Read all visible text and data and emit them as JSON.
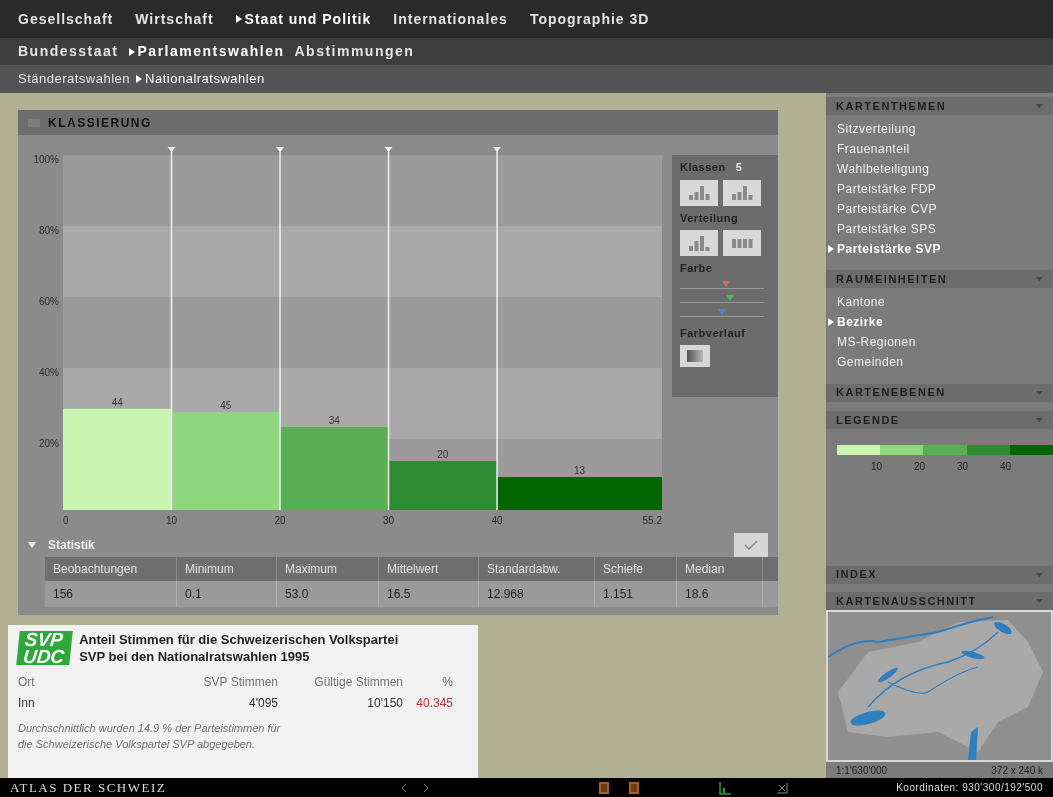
{
  "nav": {
    "level1": [
      {
        "label": "Gesellschaft",
        "selected": false
      },
      {
        "label": "Wirtschaft",
        "selected": false
      },
      {
        "label": "Staat und Politik",
        "selected": true
      },
      {
        "label": "Internationales",
        "selected": false
      },
      {
        "label": "Topographie 3D",
        "selected": false
      }
    ],
    "level2": [
      {
        "label": "Bundesstaat",
        "selected": false
      },
      {
        "label": "Parlamentswahlen",
        "selected": true
      },
      {
        "label": "Abstimmungen",
        "selected": false
      }
    ],
    "level3": [
      {
        "label": "Ständeratswahlen",
        "selected": false
      },
      {
        "label": "Nationalratswahlen",
        "selected": true
      }
    ]
  },
  "classification": {
    "title": "KLASSIERUNG",
    "chart_data": {
      "type": "bar",
      "grid": true,
      "x": [
        5,
        15,
        25,
        35,
        47.6
      ],
      "xlim": [
        0,
        55.2
      ],
      "xticks": [
        0,
        10,
        20,
        30,
        40,
        55.2
      ],
      "ylim": [
        0,
        100
      ],
      "yticks": [
        {
          "value": 20,
          "label": "20%"
        },
        {
          "value": 40,
          "label": "40%"
        },
        {
          "value": 60,
          "label": "60%"
        },
        {
          "value": 80,
          "label": "80%"
        },
        {
          "value": 100,
          "label": "100%"
        }
      ],
      "series": [
        {
          "values": [
            28.5,
            27.6,
            23.4,
            13.8,
            9.3
          ]
        }
      ],
      "colors": [
        "#c8f5b0",
        "#8fd67f",
        "#5cae55",
        "#2e8b34",
        "#006400"
      ],
      "value_labels": [
        "44",
        "45",
        "34",
        "20",
        "13"
      ]
    },
    "controls": {
      "classes_label": "Klassen",
      "classes_value": "5",
      "distribution_label": "Verteilung",
      "color_label": "Farbe",
      "color_sliders": [
        {
          "color": "#d06a6a",
          "level": 0.55
        },
        {
          "color": "#5fb05f",
          "level": 0.6
        },
        {
          "color": "#6a78d8",
          "level": 0.5
        }
      ],
      "gradient_label": "Farbverlauf"
    },
    "statistics": {
      "title": "Statistik",
      "expanded": true,
      "columns": [
        "Beobachtungen",
        "Minimum",
        "Maximum",
        "Mittelwert",
        "Standardabw.",
        "Schiefe",
        "Median"
      ],
      "row": [
        "156",
        "0.1",
        "53.0",
        "16.5",
        "12.968",
        "1.151",
        "18.6"
      ]
    }
  },
  "info": {
    "logo": [
      "SVP",
      "UDC"
    ],
    "title": "Anteil Stimmen für die Schweizerischen Volkspartei SVP bei den Nationalratswahlen 1995",
    "columns": [
      "Ort",
      "SVP Stimmen",
      "Gültige Stimmen",
      "%"
    ],
    "row": [
      "Inn",
      "4'095",
      "10'150",
      "40.345"
    ],
    "note": "Durchschnittlich wurden 14.9 % der Parteistimmen für die Schweizerische Volkspartei SVP abgegeben."
  },
  "sidebar": {
    "themes": {
      "title": "KARTENTHEMEN",
      "items": [
        {
          "label": "Sitzverteilung",
          "selected": false
        },
        {
          "label": "Frauenanteil",
          "selected": false
        },
        {
          "label": "Wahlbeteiligung",
          "selected": false
        },
        {
          "label": "Parteistärke FDP",
          "selected": false
        },
        {
          "label": "Parteistärke CVP",
          "selected": false
        },
        {
          "label": "Parteistärke SPS",
          "selected": false
        },
        {
          "label": "Parteistärke SVP",
          "selected": true
        }
      ]
    },
    "units": {
      "title": "RAUMEINHEITEN",
      "items": [
        {
          "label": "Kantone",
          "selected": false
        },
        {
          "label": "Bezirke",
          "selected": true
        },
        {
          "label": "MS-Regionen",
          "selected": false
        },
        {
          "label": "Gemeinden",
          "selected": false
        }
      ]
    },
    "layers": {
      "title": "KARTENEBENEN"
    },
    "legend": {
      "title": "LEGENDE",
      "labels": [
        "10",
        "20",
        "30",
        "40"
      ]
    },
    "index": {
      "title": "INDEX"
    },
    "overview": {
      "title": "KARTENAUSSCHNITT",
      "scale": "1:1'630'000",
      "extent": "372 x 240 k"
    }
  },
  "footer": {
    "title": "ATLAS DER SCHWEIZ",
    "coordinates": "Koordinaten: 930'300/192'500"
  }
}
